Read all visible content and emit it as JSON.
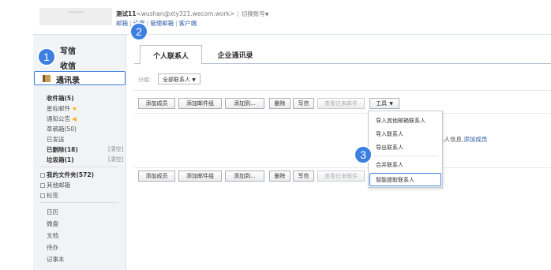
{
  "header": {
    "account_name": "测试11",
    "account_email": "<wushan@xty321.wecom.work>",
    "divider": "|",
    "switch_account": "切换账号",
    "switch_caret": "▼",
    "sublinks": [
      "邮箱",
      "设置",
      "管理邮箱",
      "客户端"
    ]
  },
  "sidebar": {
    "compose": "写信",
    "inbox": "收信",
    "contacts": "通讯录",
    "folders": [
      {
        "label": "收件箱(5)",
        "bold": true
      },
      {
        "label": "星标邮件",
        "icon": "star-icon",
        "icon_char": "★"
      },
      {
        "label": "通知公告",
        "icon": "bell-icon",
        "icon_char": "◀"
      },
      {
        "label": "草稿箱(50)",
        "bold": false
      },
      {
        "label": "已发送",
        "bold": false
      },
      {
        "label": "已删除(18)",
        "bold": true,
        "action": "[清空]"
      },
      {
        "label": "垃圾箱(1)",
        "bold": true,
        "action": "[清空]"
      }
    ],
    "tree": [
      {
        "label": "我的文件夹(572)",
        "bold": true
      },
      {
        "label": "其他邮箱",
        "bold": false
      },
      {
        "label": "标签",
        "bold": false
      }
    ],
    "apps": [
      "日历",
      "微盘",
      "文档",
      "待办",
      "记事本"
    ]
  },
  "main": {
    "tabs": [
      "个人联系人",
      "企业通讯录"
    ],
    "group_label": "分组:",
    "group_value": "全部联系人",
    "group_caret": "▼",
    "toolbar": {
      "add_contact": "添加成员",
      "add_group": "添加邮件组",
      "add_to": "添加到...",
      "delete": "删除",
      "write": "写信",
      "view_mail": "查看往来邮件",
      "tools": "工具",
      "tools_caret": "▼"
    },
    "empty_text": "系人信息,",
    "empty_link": "添加成员",
    "tools_menu": [
      "导入其他邮箱联系人",
      "导入联系人",
      "导出联系人",
      "合并联系人",
      "智能提取联系人"
    ]
  },
  "steps": [
    "1",
    "2",
    "3"
  ],
  "colors": {
    "accent": "#3f82dc",
    "badge": "#3d7fe0",
    "link": "#2b5aa8",
    "sidebar_bg": "#f2f3f5"
  }
}
